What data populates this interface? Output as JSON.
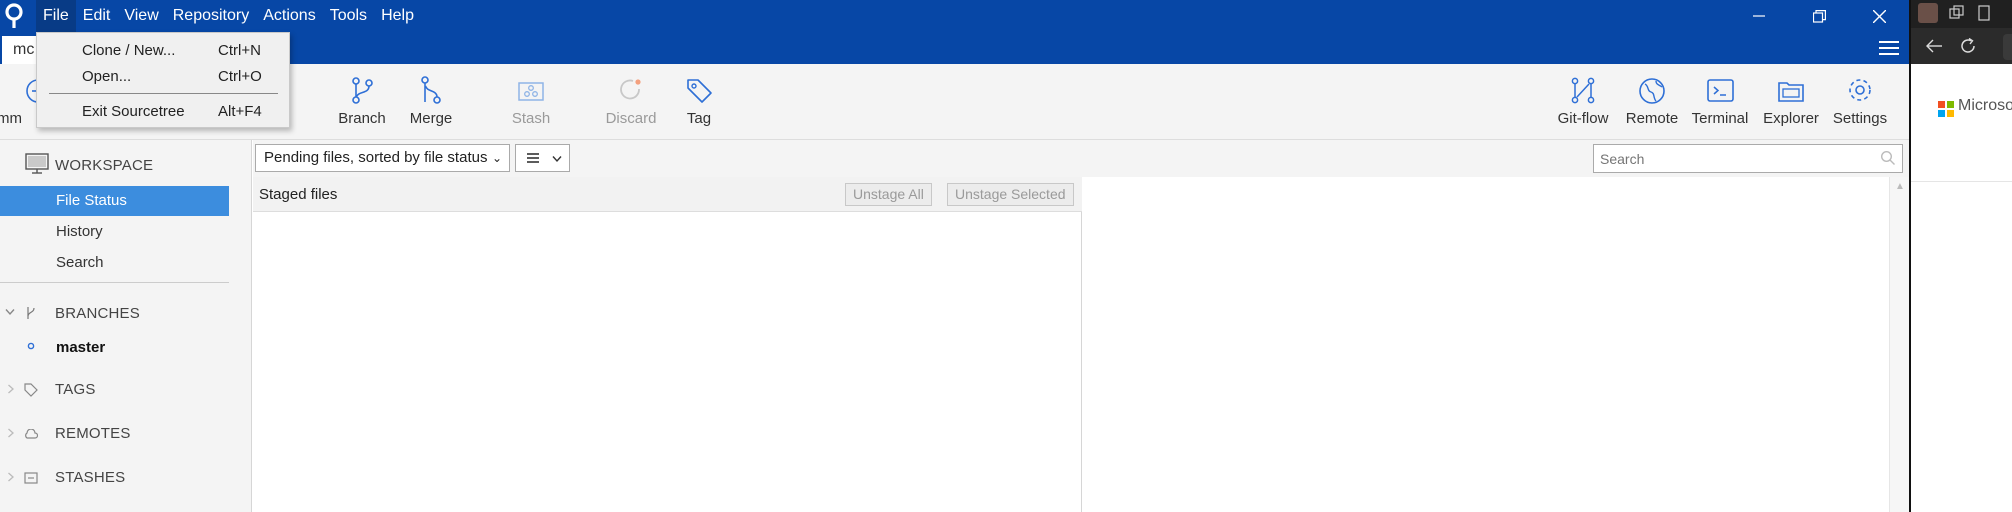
{
  "app": {
    "menu": [
      "File",
      "Edit",
      "View",
      "Repository",
      "Actions",
      "Tools",
      "Help"
    ],
    "active_menu": "File",
    "repo_tab": "mc"
  },
  "file_menu": {
    "items": [
      {
        "label": "Clone / New...",
        "shortcut": "Ctrl+N"
      },
      {
        "label": "Open...",
        "shortcut": "Ctrl+O"
      },
      {
        "label": "Exit Sourcetree",
        "shortcut": "Alt+F4"
      }
    ]
  },
  "toolbar": {
    "commit": "Comm",
    "branch": "Branch",
    "merge": "Merge",
    "stash": "Stash",
    "discard": "Discard",
    "tag": "Tag",
    "gitflow": "Git-flow",
    "remote": "Remote",
    "terminal": "Terminal",
    "explorer": "Explorer",
    "settings": "Settings"
  },
  "sidebar": {
    "workspace": "WORKSPACE",
    "items": [
      "File Status",
      "History",
      "Search"
    ],
    "selected": "File Status",
    "branches": "BRANCHES",
    "branch_items": [
      "master"
    ],
    "tags": "TAGS",
    "remotes": "REMOTES",
    "stashes": "STASHES"
  },
  "filter": {
    "selected": "Pending files, sorted by file status",
    "search_placeholder": "Search"
  },
  "staged": {
    "title": "Staged files",
    "unstage_all": "Unstage All",
    "unstage_selected": "Unstage Selected"
  },
  "browser": {
    "brand_text": "Microso"
  },
  "colors": {
    "titlebar": "#0747a6",
    "selection": "#3c8dde",
    "toolbar_bg": "#f4f4f4"
  }
}
